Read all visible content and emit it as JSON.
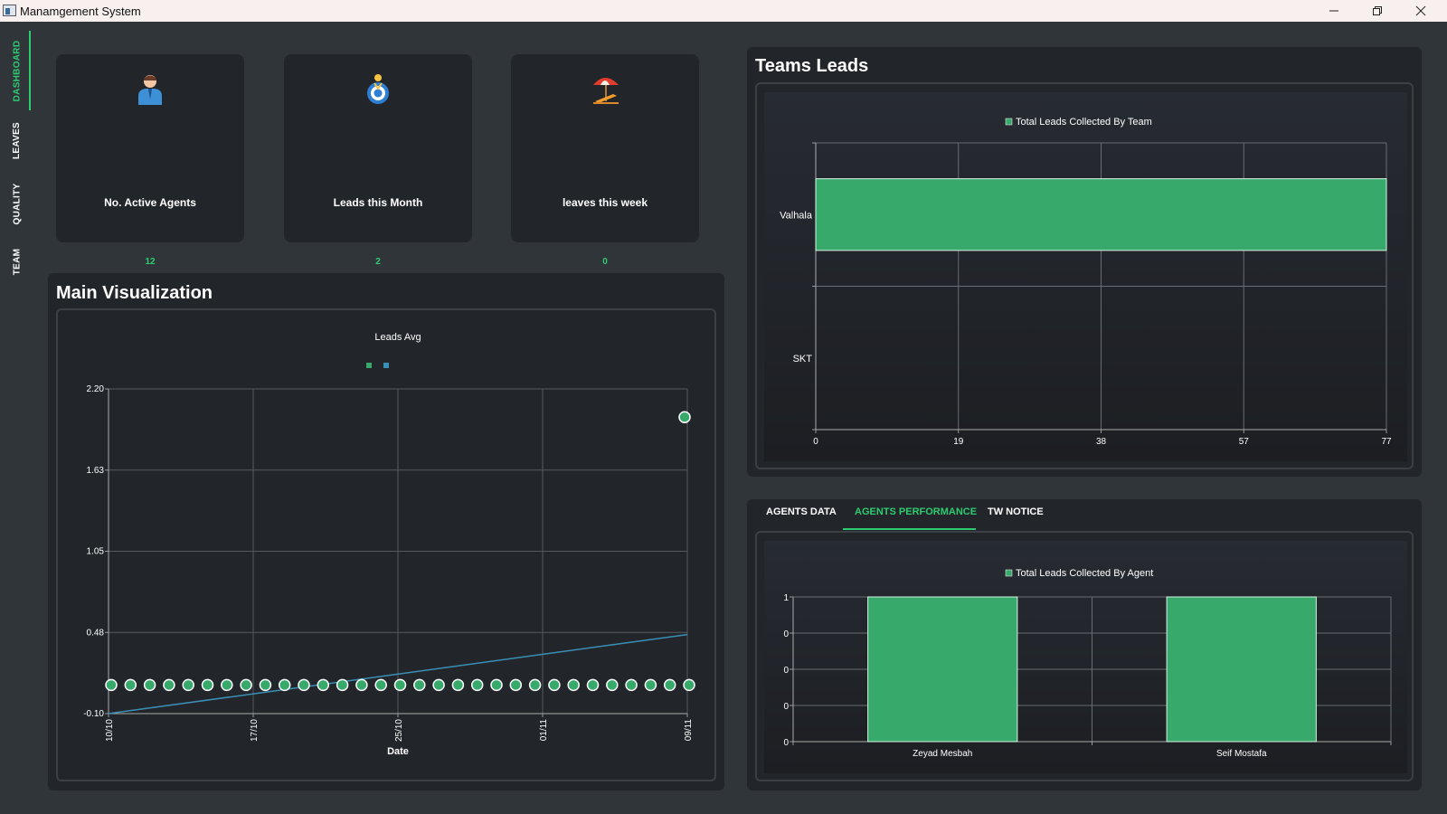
{
  "window": {
    "title": "Manamgement System"
  },
  "sidebar": {
    "tabs": [
      {
        "label": "DASHBOARD",
        "active": true
      },
      {
        "label": "LEAVES",
        "active": false
      },
      {
        "label": "QUALITY",
        "active": false
      },
      {
        "label": "TEAM",
        "active": false
      }
    ]
  },
  "cards": [
    {
      "label": "No. Active Agents",
      "value": "12",
      "icon": "agent-icon"
    },
    {
      "label": "Leads this Month",
      "value": "2",
      "icon": "target-icon"
    },
    {
      "label": "leaves this week",
      "value": "0",
      "icon": "beach-icon"
    }
  ],
  "main_viz": {
    "title": "Main Visualization"
  },
  "teams_panel": {
    "title": "Teams Leads"
  },
  "bottom_tabs": [
    {
      "label": "AGENTS DATA",
      "active": false
    },
    {
      "label": "AGENTS PERFORMANCE",
      "active": true
    },
    {
      "label": "TW NOTICE",
      "active": false
    }
  ],
  "colors": {
    "accent": "#2ecc71",
    "bar": "#36a96b",
    "line": "#3a8fb7",
    "panel": "#22262a",
    "background": "#30353a"
  },
  "chart_data": [
    {
      "type": "scatter",
      "title": "Leads Avg",
      "xlabel": "Date",
      "ylabel": "",
      "ylim": [
        -0.1,
        2.2
      ],
      "y_ticks": [
        "-0.10",
        "0.48",
        "1.05",
        "1.63",
        "2.20"
      ],
      "x_ticks": [
        "10/10",
        "17/10",
        "25/10",
        "01/11",
        "09/11"
      ],
      "legend": "top-center",
      "grid": true,
      "series": [
        {
          "kind": "scatter",
          "color": "#36a96b",
          "points": [
            0,
            0,
            0,
            0,
            0,
            0,
            0,
            0,
            0,
            0,
            0,
            0,
            0,
            0,
            0,
            0,
            0,
            0,
            0,
            0,
            0,
            0,
            0,
            0,
            0,
            0,
            0,
            0,
            0,
            0,
            0,
            2
          ]
        },
        {
          "kind": "line",
          "color": "#3a8fb7",
          "start": -0.1,
          "end": 0.46
        }
      ]
    },
    {
      "type": "bar",
      "orientation": "horizontal",
      "legend_label": "Total Leads Collected By Team",
      "categories": [
        "Valhala",
        "SKT"
      ],
      "values": [
        77,
        0
      ],
      "x_ticks": [
        "0",
        "19",
        "38",
        "57",
        "77"
      ],
      "xlim": [
        0,
        77
      ],
      "grid": true
    },
    {
      "type": "bar",
      "orientation": "vertical",
      "legend_label": "Total Leads Collected By Agent",
      "categories": [
        "Zeyad Mesbah",
        "Seif Mostafa"
      ],
      "values": [
        1,
        1
      ],
      "y_ticks": [
        "0",
        "0",
        "0",
        "0",
        "1"
      ],
      "ylim": [
        0,
        1
      ],
      "grid": true
    }
  ]
}
